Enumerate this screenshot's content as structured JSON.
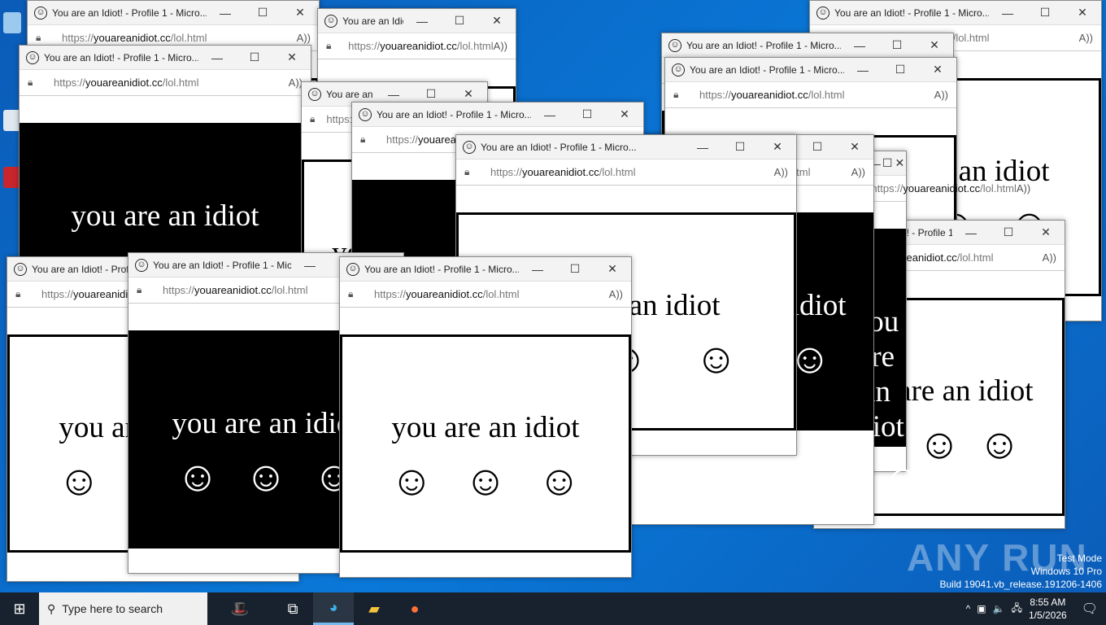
{
  "window": {
    "title": "You are an Idiot! - Profile 1 - Micro...",
    "url_prefix": "https://",
    "url_domain": "youareanidiot.cc",
    "url_path": "/lol.html",
    "message": "you are an idiot",
    "smiley": "☺",
    "minimize": "—",
    "maximize": "☐",
    "close": "✕"
  },
  "windows": [
    {
      "inverted": false
    },
    {
      "inverted": false
    },
    {
      "inverted": false
    },
    {
      "inverted": false
    },
    {
      "inverted": false
    },
    {
      "inverted": false
    },
    {
      "inverted": true
    },
    {
      "inverted": true
    },
    {
      "inverted": true
    },
    {
      "inverted": false
    },
    {
      "inverted": true
    },
    {
      "inverted": false
    },
    {
      "inverted": false
    },
    {
      "inverted": true
    },
    {
      "inverted": false
    }
  ],
  "taskbar": {
    "search_placeholder": "Type here to search",
    "time": "8:55 AM",
    "date": "1/5/2026"
  },
  "watermark": {
    "line1": "Test Mode",
    "line2": "Windows 10 Pro",
    "line3": "Build 19041.vb_release.191206-1406",
    "brand": "ANY RUN"
  }
}
